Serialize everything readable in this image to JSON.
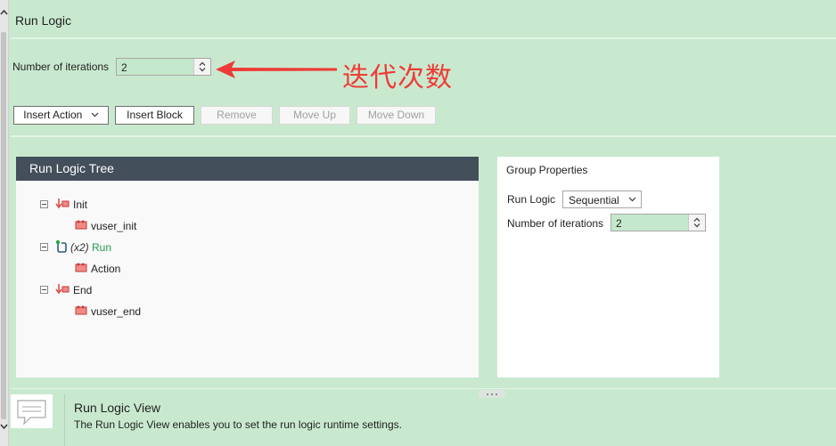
{
  "page": {
    "title": "Run Logic"
  },
  "iterations": {
    "label": "Number of iterations",
    "value": "2"
  },
  "annotation": {
    "text": "迭代次数",
    "color": "#ee3b37"
  },
  "toolbar": {
    "insert_action": "Insert Action",
    "insert_block": "Insert Block",
    "remove": "Remove",
    "move_up": "Move Up",
    "move_down": "Move Down"
  },
  "tree": {
    "header": "Run Logic Tree",
    "init": {
      "label": "Init",
      "child": "vuser_init"
    },
    "run": {
      "iterations": "(x2)",
      "label": "Run",
      "child": "Action"
    },
    "end": {
      "label": "End",
      "child": "vuser_end"
    }
  },
  "group_properties": {
    "title": "Group Properties",
    "run_logic_label": "Run Logic",
    "run_logic_value": "Sequential",
    "iterations_label": "Number of iterations",
    "iterations_value": "2"
  },
  "info": {
    "title": "Run Logic View",
    "description": "The Run Logic View enables you to set the run logic runtime settings."
  },
  "colors": {
    "background": "#c9e9cf",
    "tree_header": "#434f5a",
    "run_label": "#1f9b52",
    "action_icon": "#d9534f"
  }
}
